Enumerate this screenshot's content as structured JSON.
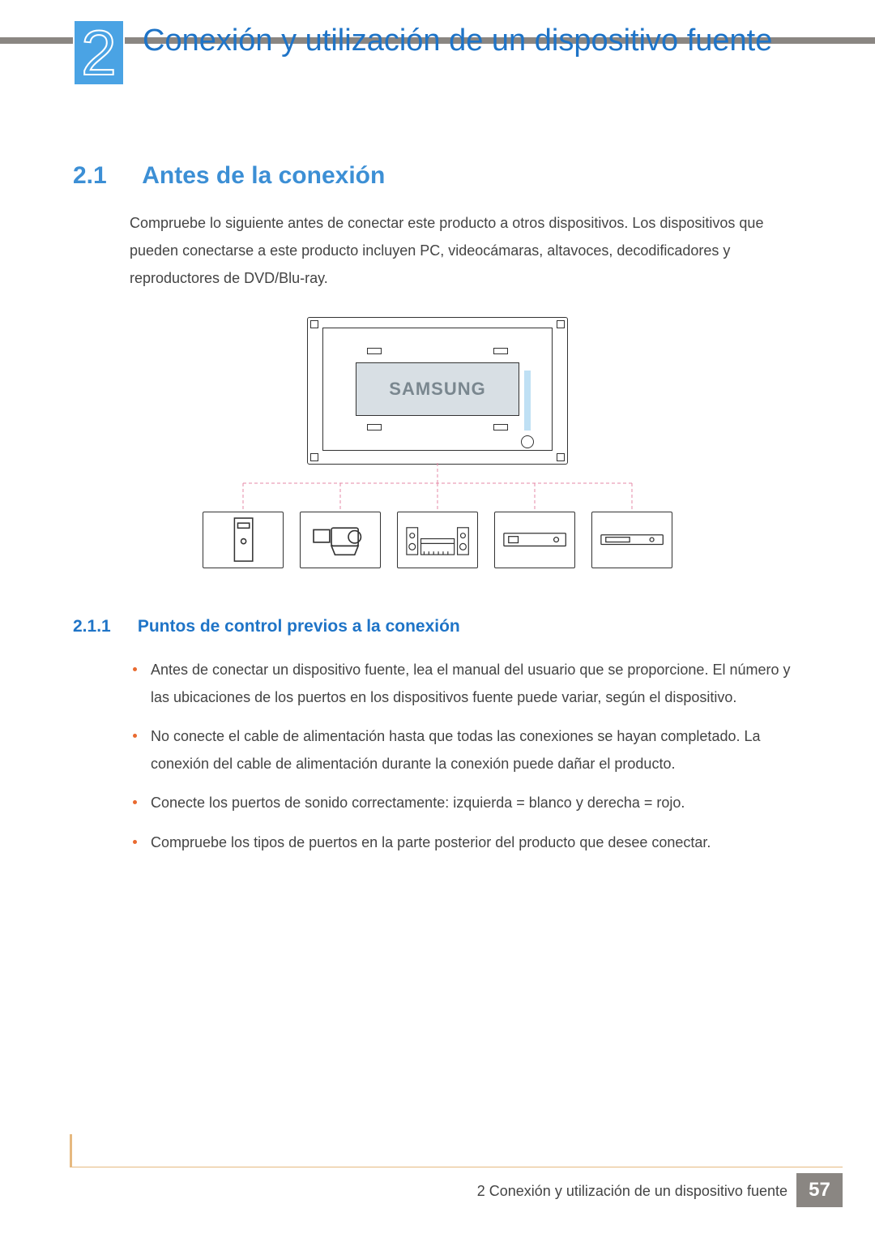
{
  "chapter": {
    "number": "2",
    "title": "Conexión y utilización de un dispositivo fuente"
  },
  "section": {
    "number": "2.1",
    "title": "Antes de la conexión",
    "intro": "Compruebe lo siguiente antes de conectar este producto a otros dispositivos. Los dispositivos que pueden conectarse a este producto incluyen PC, videocámaras, altavoces, decodificadores y reproductores de DVD/Blu-ray."
  },
  "diagram": {
    "tv_logo": "SAMSUNG",
    "devices": [
      "pc",
      "camcorder",
      "speakers",
      "set-top-box",
      "dvd-player"
    ]
  },
  "subsection": {
    "number": "2.1.1",
    "title": "Puntos de control previos a la conexión",
    "bullets": [
      "Antes de conectar un dispositivo fuente, lea el manual del usuario que se proporcione. El número y las ubicaciones de los puertos en los dispositivos fuente puede variar, según el dispositivo.",
      "No conecte el cable de alimentación hasta que todas las conexiones se hayan completado. La conexión del cable de alimentación durante la conexión puede dañar el producto.",
      "Conecte los puertos de sonido correctamente: izquierda = blanco y derecha = rojo.",
      "Compruebe los tipos de puertos en la parte posterior del producto que desee conectar."
    ]
  },
  "footer": {
    "text": "2 Conexión y utilización de un dispositivo fuente",
    "page": "57"
  }
}
